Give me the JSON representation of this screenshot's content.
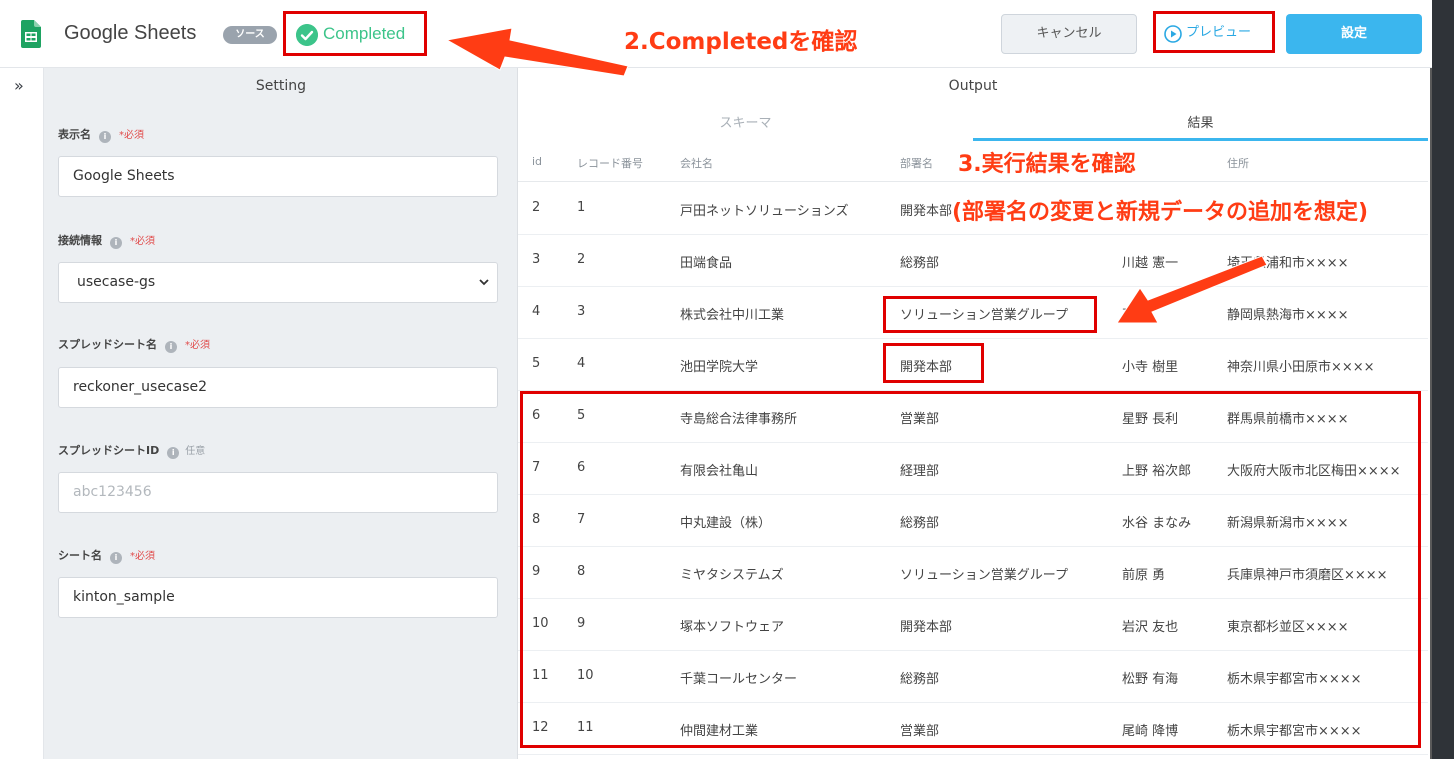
{
  "header": {
    "app_title": "Google Sheets",
    "source_badge": "ソース",
    "status": "Completed",
    "cancel_label": "キャンセル",
    "preview_label": "プレビュー",
    "set_label": "設定"
  },
  "setting": {
    "title": "Setting",
    "fields": [
      {
        "label": "表示名",
        "tag": "*必須",
        "value": "Google Sheets"
      },
      {
        "label": "接続情報",
        "tag": "*必須",
        "value": "usecase-gs"
      },
      {
        "label": "スプレッドシート名",
        "tag": "*必須",
        "value": "reckoner_usecase2"
      },
      {
        "label": "スプレッドシートID",
        "tag": "任意",
        "placeholder": "abc123456"
      },
      {
        "label": "シート名",
        "tag": "*必須",
        "value": "kinton_sample"
      }
    ]
  },
  "output": {
    "title": "Output",
    "tabs": [
      "スキーマ",
      "結果"
    ],
    "columns": [
      "id",
      "レコード番号",
      "会社名",
      "部署名",
      "",
      "住所"
    ],
    "rows": [
      [
        "2",
        "1",
        "戸田ネットソリューションズ",
        "開発本部",
        "",
        ""
      ],
      [
        "3",
        "2",
        "田端食品",
        "総務部",
        "川越 憲一",
        "埼玉県浦和市××××"
      ],
      [
        "4",
        "3",
        "株式会社中川工業",
        "ソリューション営業グループ",
        "戸",
        "静岡県熱海市××××"
      ],
      [
        "5",
        "4",
        "池田学院大学",
        "開発本部",
        "小寺 樹里",
        "神奈川県小田原市××××"
      ],
      [
        "6",
        "5",
        "寺島総合法律事務所",
        "営業部",
        "星野 長利",
        "群馬県前橋市××××"
      ],
      [
        "7",
        "6",
        "有限会社亀山",
        "経理部",
        "上野 裕次郎",
        "大阪府大阪市北区梅田××××"
      ],
      [
        "8",
        "7",
        "中丸建設（株）",
        "総務部",
        "水谷 まなみ",
        "新潟県新潟市××××"
      ],
      [
        "9",
        "8",
        "ミヤタシステムズ",
        "ソリューション営業グループ",
        "前原 勇",
        "兵庫県神戸市須磨区××××"
      ],
      [
        "10",
        "9",
        "塚本ソフトウェア",
        "開発本部",
        "岩沢 友也",
        "東京都杉並区××××"
      ],
      [
        "11",
        "10",
        "千葉コールセンター",
        "総務部",
        "松野 有海",
        "栃木県宇都宮市××××"
      ],
      [
        "12",
        "11",
        "仲間建材工業",
        "営業部",
        "尾崎 降博",
        "栃木県宇都宮市××××"
      ]
    ]
  },
  "annotations": {
    "step2": "2.Completedを確認",
    "step3": "3.実行結果を確認",
    "step3_note": "(部署名の変更と新規データの追加を想定)"
  },
  "colors": {
    "accent": "#3bb6ee",
    "success": "#3cc48a",
    "annotation": "#ff3c14",
    "highlight_box": "#e00000"
  }
}
